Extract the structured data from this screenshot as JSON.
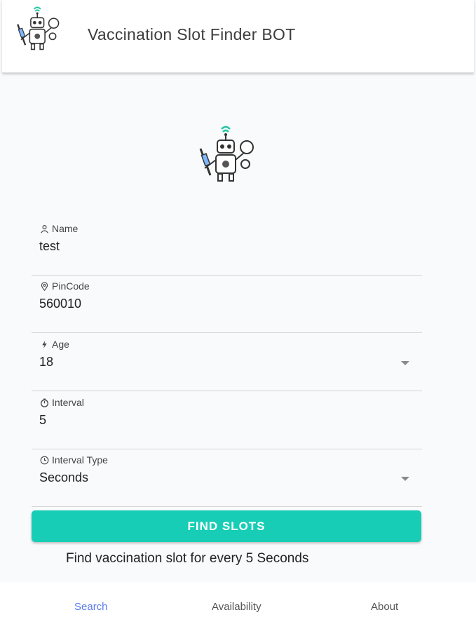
{
  "header": {
    "title": "Vaccination Slot Finder BOT"
  },
  "form": {
    "name": {
      "label": "Name",
      "value": "test",
      "icon": "person-icon"
    },
    "pincode": {
      "label": "PinCode",
      "value": "560010",
      "icon": "location-pin-icon"
    },
    "age": {
      "label": "Age",
      "value": "18",
      "icon": "lightning-icon"
    },
    "interval": {
      "label": "Interval",
      "value": "5",
      "icon": "timer-icon"
    },
    "interval_type": {
      "label": "Interval Type",
      "value": "Seconds",
      "icon": "clock-icon"
    }
  },
  "actions": {
    "find_label": "FIND SLOTS"
  },
  "status": {
    "message": "Find vaccination slot for every 5 Seconds"
  },
  "nav": {
    "items": [
      {
        "label": "Search",
        "active": true
      },
      {
        "label": "Availability",
        "active": false
      },
      {
        "label": "About",
        "active": false
      }
    ]
  },
  "colors": {
    "accent": "#18cdb6",
    "active_nav": "#5b7cf0",
    "background": "#f8fafc"
  }
}
